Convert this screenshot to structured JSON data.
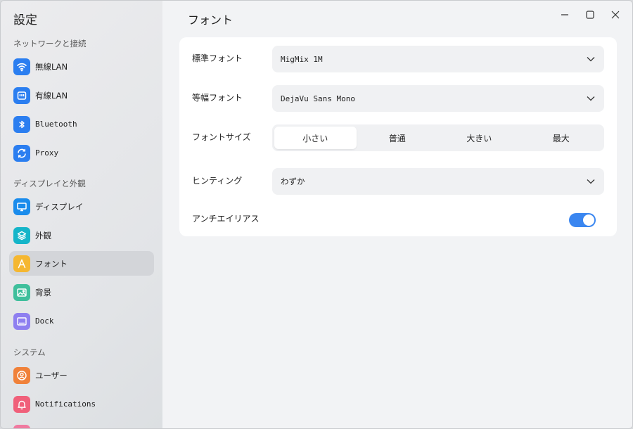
{
  "app": {
    "title": "設定"
  },
  "sidebar": {
    "sections": [
      {
        "label": "ネットワークと接続"
      },
      {
        "label": "ディスプレイと外観"
      },
      {
        "label": "システム"
      }
    ],
    "items": [
      {
        "label": "無線LAN",
        "icon": "wifi-icon",
        "color": "#2b7ef0"
      },
      {
        "label": "有線LAN",
        "icon": "ethernet-icon",
        "color": "#2b7ef0"
      },
      {
        "label": "Bluetooth",
        "icon": "bluetooth-icon",
        "color": "#2b7ef0"
      },
      {
        "label": "Proxy",
        "icon": "sync-icon",
        "color": "#2b7ef0"
      },
      {
        "label": "ディスプレイ",
        "icon": "monitor-icon",
        "color": "#1a8cec"
      },
      {
        "label": "外観",
        "icon": "layers-icon",
        "color": "#15b5c9"
      },
      {
        "label": "フォント",
        "icon": "font-icon",
        "color": "#f5b731"
      },
      {
        "label": "背景",
        "icon": "image-icon",
        "color": "#3fbf9c"
      },
      {
        "label": "Dock",
        "icon": "dock-icon",
        "color": "#8e7ff0"
      },
      {
        "label": "ユーザー",
        "icon": "user-icon",
        "color": "#f0813a"
      },
      {
        "label": "Notifications",
        "icon": "bell-icon",
        "color": "#f0607a"
      }
    ]
  },
  "main": {
    "title": "フォント",
    "standard_font": {
      "label": "標準フォント",
      "value": "MigMix 1M"
    },
    "mono_font": {
      "label": "等幅フォント",
      "value": "DejaVu Sans Mono"
    },
    "font_size": {
      "label": "フォントサイズ",
      "options": [
        "小さい",
        "普通",
        "大きい",
        "最大"
      ],
      "selected": "小さい"
    },
    "hinting": {
      "label": "ヒンティング",
      "value": "わずか"
    },
    "antialiasing": {
      "label": "アンチエイリアス",
      "enabled": true
    }
  },
  "colors": {
    "accent": "#3a86f0"
  }
}
